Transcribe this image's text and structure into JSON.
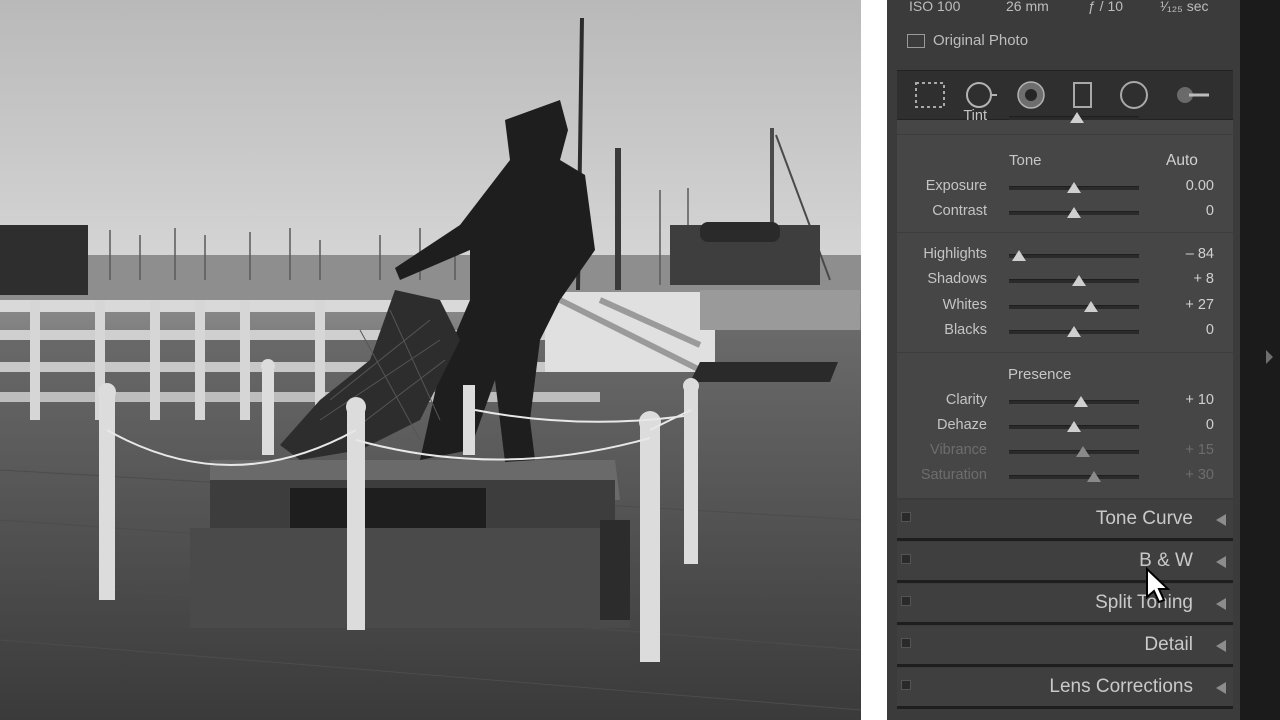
{
  "exif": {
    "iso": "ISO 100",
    "focal": "26 mm",
    "aperture": "ƒ / 10",
    "shutter": "¹⁄₁₂₅ sec"
  },
  "original_photo_label": "Original Photo",
  "tools": [
    "crop-overlay-icon",
    "spot-removal-icon",
    "red-eye-icon",
    "graduated-filter-icon",
    "radial-filter-icon",
    "adjustment-brush-icon"
  ],
  "basic": {
    "tint_label": "Tint",
    "tone_title": "Tone",
    "auto_label": "Auto",
    "tone_rows": [
      {
        "label": "Exposure",
        "value": "0.00",
        "position": 0.5
      },
      {
        "label": "Contrast",
        "value": "0",
        "position": 0.5
      },
      {
        "label": "Highlights",
        "value": "– 84",
        "position": 0.08
      },
      {
        "label": "Shadows",
        "value": "+ 8",
        "position": 0.54
      },
      {
        "label": "Whites",
        "value": "+ 27",
        "position": 0.63
      },
      {
        "label": "Blacks",
        "value": "0",
        "position": 0.5
      }
    ],
    "presence_title": "Presence",
    "presence_rows": [
      {
        "label": "Clarity",
        "value": "+ 10",
        "position": 0.55,
        "dim": false
      },
      {
        "label": "Dehaze",
        "value": "0",
        "position": 0.5,
        "dim": false
      },
      {
        "label": "Vibrance",
        "value": "+ 15",
        "position": 0.57,
        "dim": true
      },
      {
        "label": "Saturation",
        "value": "+ 30",
        "position": 0.65,
        "dim": true
      }
    ]
  },
  "panels": [
    "Tone Curve",
    "B & W",
    "Split Toning",
    "Detail",
    "Lens Corrections"
  ],
  "colors": {
    "panel_bg": "#3b3b3b",
    "section_bg": "#464646",
    "text": "#c4c4c4"
  }
}
